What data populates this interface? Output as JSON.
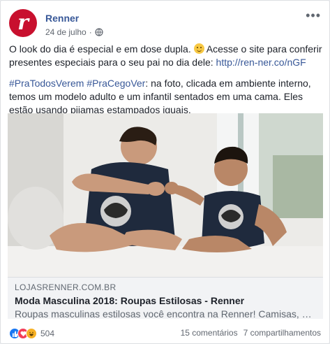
{
  "post": {
    "page_name": "Renner",
    "date": "24 de julho",
    "separator": "·",
    "avatar_letter": "r",
    "text_line1": "O look do dia é especial e em dose dupla.",
    "text_line1b": " Acesse o site para conferir presentes especiais para o seu pai no dia dele: ",
    "link_url": "http://ren-ner.co/nGF",
    "hashtags": "#PraTodosVerem #PraCegoVer",
    "description": ": na foto, clicada em ambiente interno, temos um modelo adulto e um infantil sentados em uma cama. Eles estão usando pijamas estampados iguais.",
    "more_icon": "more-horizontal-icon",
    "privacy_icon": "globe-icon"
  },
  "link_preview": {
    "domain": "LOJASRENNER.COM.BR",
    "title": "Moda Masculina 2018: Roupas Estilosas - Renner",
    "description": "Roupas masculinas estilosas você encontra na Renner! Camisas, calças, bermudas e muito mais."
  },
  "footer": {
    "reaction_count": "504",
    "comments": "15 comentários",
    "shares": "7 compartilhamentos"
  },
  "colors": {
    "brand": "#c8102e",
    "link": "#385898",
    "like": "#1877f2",
    "love": "#f33e58",
    "haha": "#f7b125"
  }
}
